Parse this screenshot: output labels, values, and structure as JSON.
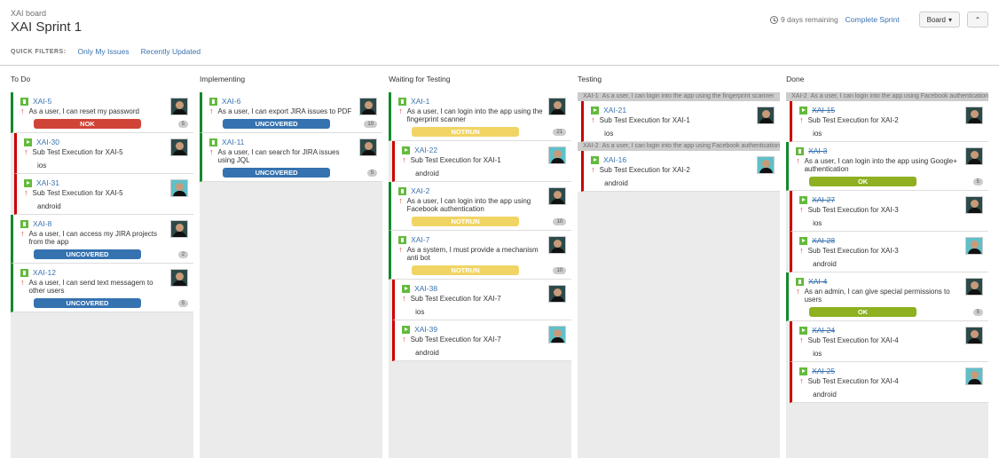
{
  "header": {
    "board_name": "XAI board",
    "sprint_title": "XAI Sprint 1",
    "quick_filters_label": "QUICK FILTERS:",
    "filters": [
      "Only My Issues",
      "Recently Updated"
    ],
    "remaining": "9 days remaining",
    "complete_sprint": "Complete Sprint",
    "board_button": "Board",
    "collapse_icon": "double-chevron-up"
  },
  "columns": [
    {
      "title": "To Do",
      "cards": [
        {
          "key": "XAI-5",
          "type": "story",
          "summary": "As a user, I can reset my password",
          "status": "NOK",
          "status_class": "nok",
          "points": "5",
          "avatar": "dark"
        },
        {
          "key": "XAI-30",
          "type": "exec",
          "summary": "Sub Test Execution for XAI-5",
          "extra": "ios",
          "avatar": "dark"
        },
        {
          "key": "XAI-31",
          "type": "exec",
          "summary": "Sub Test Execution for XAI-5",
          "extra": "android",
          "avatar": "light"
        },
        {
          "key": "XAI-8",
          "type": "story",
          "summary": "As a user, I can access my JIRA projects from the app",
          "status": "UNCOVERED",
          "status_class": "unc",
          "points": "2",
          "avatar": "dark"
        },
        {
          "key": "XAI-12",
          "type": "story",
          "summary": "As a user, I can send text messagem to other users",
          "status": "UNCOVERED",
          "status_class": "unc",
          "points": "5",
          "avatar": "dark"
        }
      ]
    },
    {
      "title": "Implementing",
      "cards": [
        {
          "key": "XAI-6",
          "type": "story",
          "summary": "As a user, I can export JIRA issues to PDF",
          "status": "UNCOVERED",
          "status_class": "unc",
          "points": "10",
          "avatar": "dark"
        },
        {
          "key": "XAI-11",
          "type": "story",
          "summary": "As a user, I can search for JIRA issues using JQL",
          "status": "UNCOVERED",
          "status_class": "unc",
          "points": "5",
          "avatar": "dark"
        }
      ]
    },
    {
      "title": "Waiting for Testing",
      "cards": [
        {
          "key": "XAI-1",
          "type": "story",
          "summary": "As a user, I can login into the app using the fingerprint scanner",
          "status": "NOTRUN",
          "status_class": "notrun",
          "points": "21",
          "avatar": "dark"
        },
        {
          "key": "XAI-22",
          "type": "exec",
          "summary": "Sub Test Execution for XAI-1",
          "extra": "android",
          "avatar": "light"
        },
        {
          "key": "XAI-2",
          "type": "story",
          "summary": "As a user, I can login into the app using Facebook authentication",
          "status": "NOTRUN",
          "status_class": "notrun",
          "points": "10",
          "avatar": "dark"
        },
        {
          "key": "XAI-7",
          "type": "story",
          "summary": "As a system, I must provide a mechanism anti bot",
          "status": "NOTRUN",
          "status_class": "notrun",
          "points": "10",
          "avatar": "dark"
        },
        {
          "key": "XAI-38",
          "type": "exec",
          "summary": "Sub Test Execution for XAI-7",
          "extra": "ios",
          "avatar": "dark"
        },
        {
          "key": "XAI-39",
          "type": "exec",
          "summary": "Sub Test Execution for XAI-7",
          "extra": "android",
          "avatar": "light"
        }
      ]
    },
    {
      "title": "Testing",
      "groups": [
        {
          "parent_key": "XAI-1",
          "parent_summary": "As a user, I can login into the app using the fingerprint scanner",
          "cards": [
            {
              "key": "XAI-21",
              "type": "exec",
              "summary": "Sub Test Execution for XAI-1",
              "extra": "ios",
              "avatar": "dark"
            }
          ]
        },
        {
          "parent_key": "XAI-2",
          "parent_summary": "As a user, I can login into the app using Facebook authentication",
          "cards": [
            {
              "key": "XAI-16",
              "type": "exec",
              "summary": "Sub Test Execution for XAI-2",
              "extra": "android",
              "avatar": "light"
            }
          ]
        }
      ]
    },
    {
      "title": "Done",
      "groups": [
        {
          "parent_key": "XAI-2",
          "parent_summary": "As a user, I can login into the app using Facebook authentication",
          "cards": [
            {
              "key": "XAI-15",
              "type": "exec",
              "done": true,
              "summary": "Sub Test Execution for XAI-2",
              "extra": "ios",
              "avatar": "dark"
            }
          ]
        }
      ],
      "cards": [
        {
          "key": "XAI-3",
          "type": "story",
          "done": true,
          "summary": "As a user, I can login into the app using Google+ authentication",
          "status": "OK",
          "status_class": "ok",
          "points": "5",
          "avatar": "dark"
        },
        {
          "key": "XAI-27",
          "type": "exec",
          "done": true,
          "summary": "Sub Test Execution for XAI-3",
          "extra": "ios",
          "avatar": "dark"
        },
        {
          "key": "XAI-28",
          "type": "exec",
          "done": true,
          "summary": "Sub Test Execution for XAI-3",
          "extra": "android",
          "avatar": "light"
        },
        {
          "key": "XAI-4",
          "type": "story",
          "done": true,
          "summary": "As an admin, I can give special permissions to users",
          "status": "OK",
          "status_class": "ok",
          "points": "5",
          "avatar": "dark"
        },
        {
          "key": "XAI-24",
          "type": "exec",
          "done": true,
          "summary": "Sub Test Execution for XAI-4",
          "extra": "ios",
          "avatar": "dark"
        },
        {
          "key": "XAI-25",
          "type": "exec",
          "done": true,
          "summary": "Sub Test Execution for XAI-4",
          "extra": "android",
          "avatar": "light"
        }
      ]
    }
  ]
}
